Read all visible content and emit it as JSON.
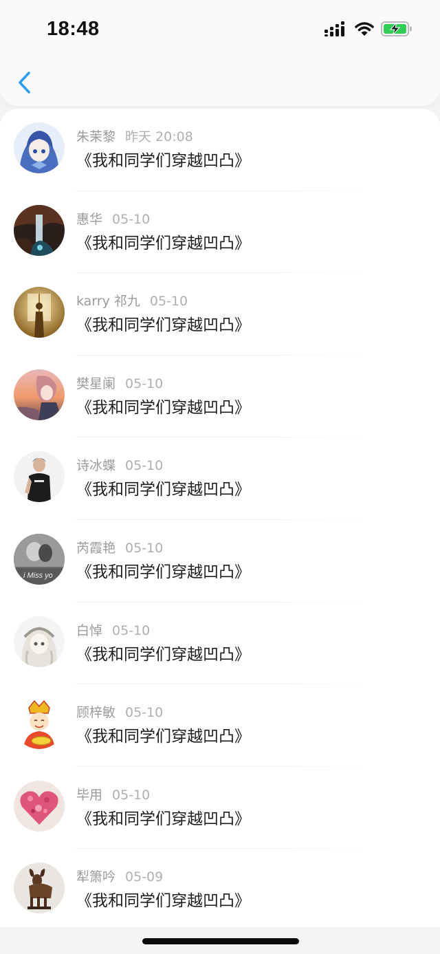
{
  "status_bar": {
    "time": "18:48",
    "icons": [
      "signal-icon",
      "wifi-icon",
      "battery-charging-icon"
    ]
  },
  "nav": {
    "back_icon": "chevron-left-icon",
    "accent": "#2d9df0"
  },
  "list": {
    "items": [
      {
        "name": "朱茉黎",
        "time": "昨天 20:08",
        "title": "《我和同学们穿越凹凸》",
        "avatar": "anime-girl-blue"
      },
      {
        "name": "惠华",
        "time": "05-10",
        "title": "《我和同学们穿越凹凸》",
        "avatar": "waterfall-night"
      },
      {
        "name": "karry 祁九",
        "time": "05-10",
        "title": "《我和同学们穿越凹凸》",
        "avatar": "window-silhouette"
      },
      {
        "name": "樊星阑",
        "time": "05-10",
        "title": "《我和同学们穿越凹凸》",
        "avatar": "anime-sunset"
      },
      {
        "name": "诗冰蝶",
        "time": "05-10",
        "title": "《我和同学们穿越凹凸》",
        "avatar": "man-black-shirt"
      },
      {
        "name": "芮霞艳",
        "time": "05-10",
        "title": "《我和同学们穿越凹凸》",
        "avatar": "i-miss-you-gray",
        "avatar_text": "i Miss yo"
      },
      {
        "name": "白悼",
        "time": "05-10",
        "title": "《我和同学们穿越凹凸》",
        "avatar": "anime-girl-white"
      },
      {
        "name": "顾梓敏",
        "time": "05-10",
        "title": "《我和同学们穿越凹凸》",
        "avatar": "god-of-wealth"
      },
      {
        "name": "毕用",
        "time": "05-10",
        "title": "《我和同学们穿越凹凸》",
        "avatar": "pink-petal-heart"
      },
      {
        "name": "犁箫吟",
        "time": "05-09",
        "title": "《我和同学们穿越凹凸》",
        "avatar": "bronze-goat"
      }
    ]
  }
}
